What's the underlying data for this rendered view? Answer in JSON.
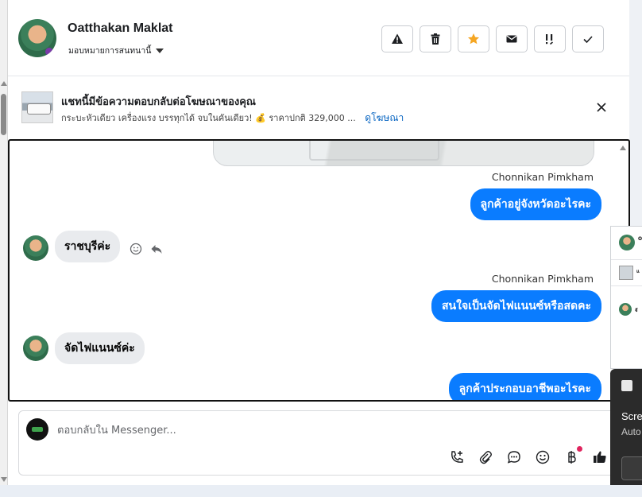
{
  "header": {
    "contact_name": "Oatthakan Maklat",
    "assign_label": "มอบหมายการสนทนานี้",
    "actions": [
      {
        "name": "spam-button",
        "icon": "warning-icon"
      },
      {
        "name": "delete-button",
        "icon": "trash-icon"
      },
      {
        "name": "star-button",
        "icon": "star-icon"
      },
      {
        "name": "mark-unread-button",
        "icon": "envelope-icon"
      },
      {
        "name": "follow-up-button",
        "icon": "exclamation-icon"
      },
      {
        "name": "mark-done-button",
        "icon": "check-icon"
      }
    ],
    "star_color": "#f5a623"
  },
  "ad": {
    "title": "แชทนี้มีข้อความตอบกลับต่อโฆษณาของคุณ",
    "subtitle": "กระบะหัวเดียว เครื่องแรง บรรทุกได้ จบในคันเดียว! 💰 ราคาปกติ 329,000 ...",
    "link": "ดูโฆษณา"
  },
  "messages": {
    "sender_1": "Chonnikan Pimkham",
    "out_1": "ลูกค้าอยู่จังหวัดอะไรคะ",
    "in_1": "ราชบุรีค่ะ",
    "sender_2": "Chonnikan Pimkham",
    "out_2": "สนใจเป็นจัดไฟแนนซ์หรือสดคะ",
    "in_2": "จัดไฟแนนซ์ค่ะ",
    "out_3": "ลูกค้าประกอบอาชีพอะไรคะ"
  },
  "composer": {
    "placeholder": "ตอบกลับใน Messenger...",
    "tools": [
      "call-add-icon",
      "attachment-icon",
      "saved-reply-icon",
      "emoji-icon",
      "baht-icon",
      "thumbs-up-icon"
    ],
    "accent": "#0a7cff"
  },
  "side_panel": {
    "row1_initial": "O",
    "row2_initial": "แ",
    "row3_initial": "จั"
  },
  "toast": {
    "title": "Scre",
    "subtitle": "Auto"
  }
}
